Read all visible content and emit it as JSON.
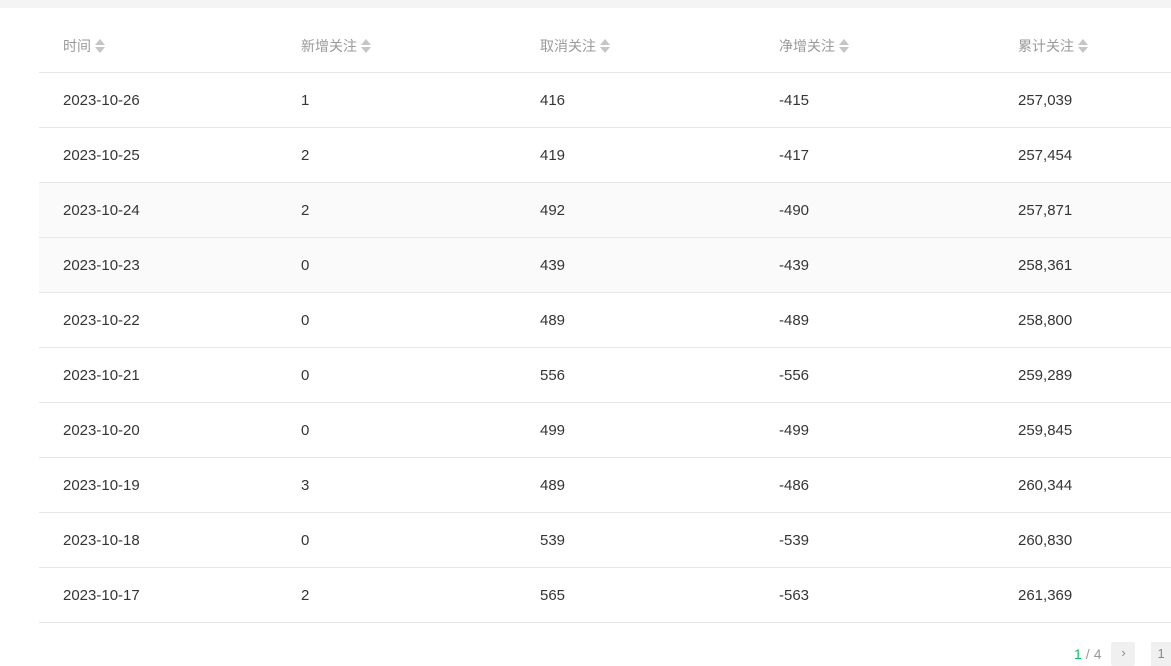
{
  "table": {
    "headers": [
      "时间",
      "新增关注",
      "取消关注",
      "净增关注",
      "累计关注"
    ],
    "rows": [
      [
        "2023-10-26",
        "1",
        "416",
        "-415",
        "257,039"
      ],
      [
        "2023-10-25",
        "2",
        "419",
        "-417",
        "257,454"
      ],
      [
        "2023-10-24",
        "2",
        "492",
        "-490",
        "257,871"
      ],
      [
        "2023-10-23",
        "0",
        "439",
        "-439",
        "258,361"
      ],
      [
        "2023-10-22",
        "0",
        "489",
        "-489",
        "258,800"
      ],
      [
        "2023-10-21",
        "0",
        "556",
        "-556",
        "259,289"
      ],
      [
        "2023-10-20",
        "0",
        "499",
        "-499",
        "259,845"
      ],
      [
        "2023-10-19",
        "3",
        "489",
        "-486",
        "260,344"
      ],
      [
        "2023-10-18",
        "0",
        "539",
        "-539",
        "260,830"
      ],
      [
        "2023-10-17",
        "2",
        "565",
        "-563",
        "261,369"
      ]
    ]
  },
  "pagination": {
    "current": "1",
    "separator": "/",
    "total": "4",
    "next_icon": "chevron-right-icon",
    "next_glyph": "›",
    "jump_value": "1"
  },
  "colors": {
    "accent": "#07c160",
    "header_text": "#9a9a9a",
    "row_text": "#353535",
    "border": "#e7e7eb",
    "hover_row": "#fafafa"
  }
}
